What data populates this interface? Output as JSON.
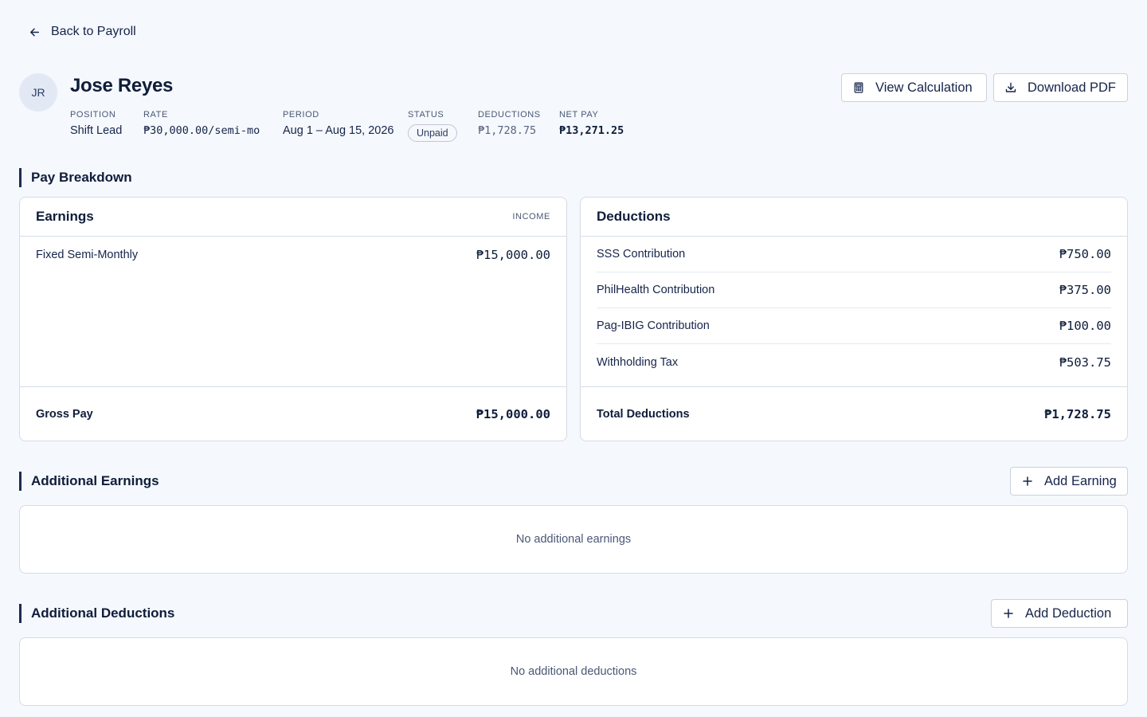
{
  "nav": {
    "back_label": "Back to Payroll"
  },
  "employee": {
    "initials": "JR",
    "name": "Jose Reyes",
    "position_label": "POSITION",
    "position": "Shift Lead",
    "rate_label": "RATE",
    "rate": "₱30,000.00/semi-mo",
    "period_label": "PERIOD",
    "period": "Aug 1 – Aug 15, 2026",
    "status_label": "STATUS",
    "status": "Unpaid",
    "deductions_label": "DEDUCTIONS",
    "deductions": "₱1,728.75",
    "net_pay_label": "NET PAY",
    "net_pay": "₱13,271.25"
  },
  "actions": {
    "view_calculation": "View Calculation",
    "download_pdf": "Download PDF"
  },
  "pay_breakdown": {
    "title": "Pay Breakdown",
    "earnings": {
      "title": "Earnings",
      "tag": "INCOME",
      "items": [
        {
          "label": "Fixed Semi-Monthly",
          "amount": "₱15,000.00"
        }
      ],
      "total_label": "Gross Pay",
      "total": "₱15,000.00"
    },
    "deductions": {
      "title": "Deductions",
      "items": [
        {
          "label": "SSS Contribution",
          "amount": "₱750.00"
        },
        {
          "label": "PhilHealth Contribution",
          "amount": "₱375.00"
        },
        {
          "label": "Pag-IBIG Contribution",
          "amount": "₱100.00"
        },
        {
          "label": "Withholding Tax",
          "amount": "₱503.75"
        }
      ],
      "total_label": "Total Deductions",
      "total": "₱1,728.75"
    }
  },
  "additional_earnings": {
    "title": "Additional Earnings",
    "add_label": "Add Earning",
    "empty_text": "No additional earnings"
  },
  "additional_deductions": {
    "title": "Additional Deductions",
    "add_label": "Add Deduction",
    "empty_text": "No additional deductions"
  }
}
